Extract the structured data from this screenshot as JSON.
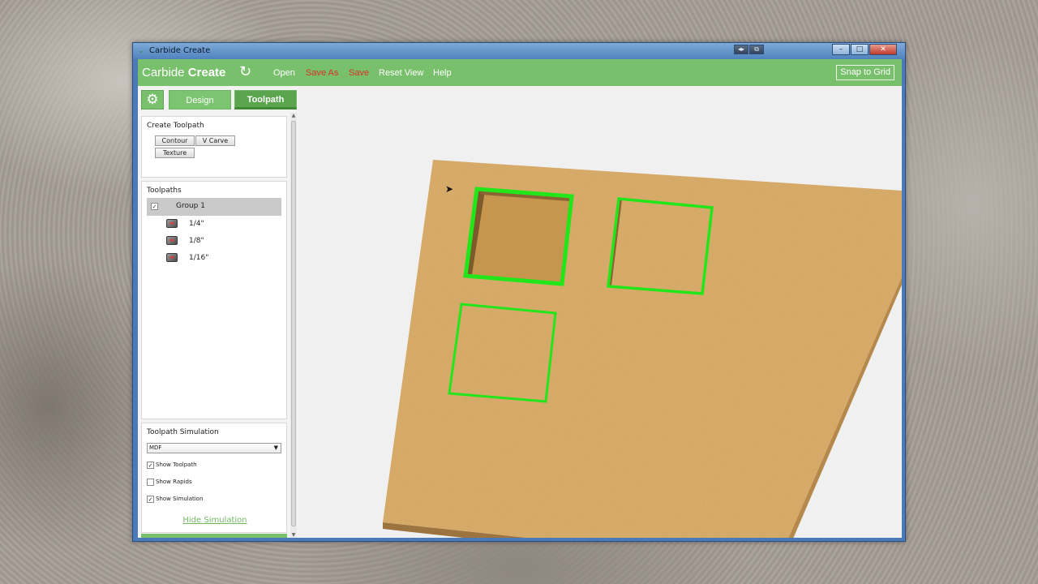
{
  "window": {
    "title": "Carbide Create"
  },
  "menubar": {
    "brand_light": "Carbide",
    "brand_bold": "Create",
    "items": {
      "open": "Open",
      "save_as": "Save As",
      "save": "Save",
      "reset_view": "Reset View",
      "help": "Help"
    },
    "snap": "Snap to Grid"
  },
  "tabs": {
    "design": "Design",
    "toolpath": "Toolpath"
  },
  "create_toolpath": {
    "title": "Create Toolpath",
    "buttons": {
      "contour": "Contour",
      "vcarve": "V Carve",
      "texture": "Texture"
    }
  },
  "toolpaths": {
    "title": "Toolpaths",
    "group": "Group 1",
    "items": [
      "1/4\"",
      "1/8\"",
      "1/16\""
    ]
  },
  "simulation": {
    "title": "Toolpath Simulation",
    "material": "MDF",
    "options": {
      "show_toolpath": "Show Toolpath",
      "show_rapids": "Show Rapids",
      "show_simulation": "Show Simulation"
    },
    "hide_link": "Hide Simulation"
  },
  "colors": {
    "accent": "#78c06c",
    "toolpath_line": "#22e61a",
    "stock": "#d8a85c",
    "red_menu": "#d9302a"
  },
  "icons": [
    "gear-icon",
    "refresh-icon",
    "tool-icon",
    "cursor-icon",
    "minimize-icon",
    "maximize-icon",
    "close-icon"
  ]
}
